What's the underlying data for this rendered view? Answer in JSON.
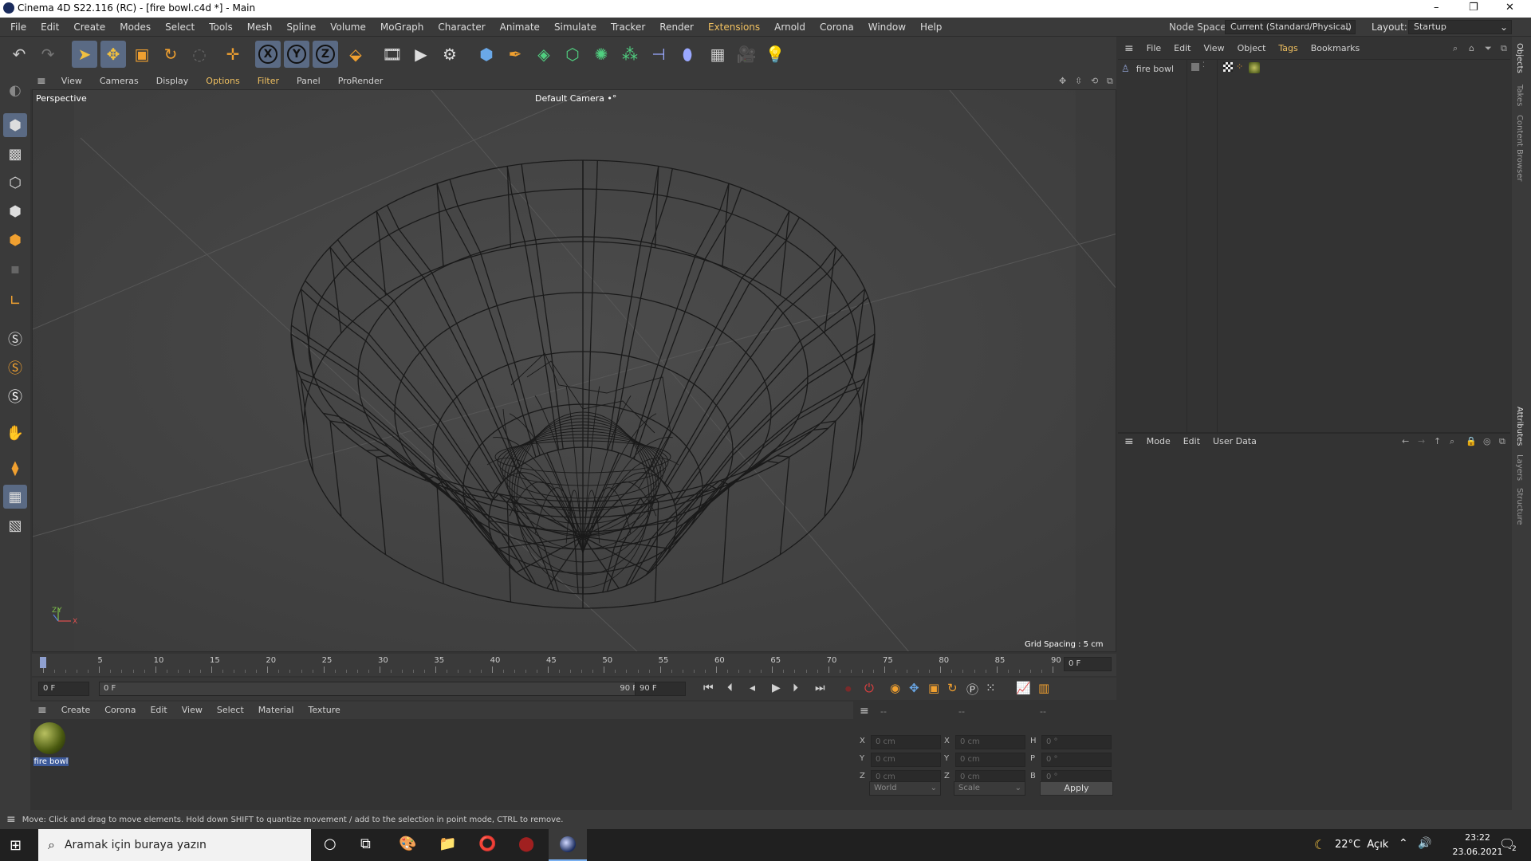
{
  "window": {
    "title": "Cinema 4D S22.116 (RC) - [fire bowl.c4d *] - Main",
    "controls": [
      "–",
      "❐",
      "✕"
    ]
  },
  "menubar": {
    "items": [
      "File",
      "Edit",
      "Create",
      "Modes",
      "Select",
      "Tools",
      "Mesh",
      "Spline",
      "Volume",
      "MoGraph",
      "Character",
      "Animate",
      "Simulate",
      "Tracker",
      "Render",
      "Extensions",
      "Arnold",
      "Corona",
      "Window",
      "Help"
    ],
    "node_space_label": "Node Space:",
    "node_space_value": "Current (Standard/Physical)",
    "layout_label": "Layout:",
    "layout_value": "Startup"
  },
  "toolbar": {
    "icons": [
      "undo-icon",
      "redo-icon",
      "select-cursor-icon",
      "move-icon",
      "scale-icon",
      "rotate-icon",
      "recent-icon",
      "add-object-icon",
      "lock-x-icon",
      "lock-y-icon",
      "lock-z-icon",
      "coordinate-system-icon",
      "render-view-icon",
      "render-picture-viewer-icon",
      "render-settings-icon",
      "cube-icon",
      "pen-icon",
      "subdivision-icon",
      "extrude-icon",
      "cloner-icon",
      "mograph-icon",
      "deformer-icon",
      "field-icon",
      "floor-icon",
      "camera-icon",
      "light-icon"
    ],
    "xyz": [
      "X",
      "Y",
      "Z"
    ]
  },
  "viewport": {
    "menu": [
      "View",
      "Cameras",
      "Display",
      "Options",
      "Filter",
      "Panel",
      "ProRender"
    ],
    "name": "Perspective",
    "camera": "Default Camera",
    "camera_suffix": "•°",
    "grid_spacing": "Grid Spacing : 5 cm",
    "axis": {
      "z": "Z",
      "y": "Y",
      "x": "X"
    }
  },
  "timeline": {
    "ticks": [
      "0",
      "5",
      "10",
      "15",
      "20",
      "25",
      "30",
      "35",
      "40",
      "45",
      "50",
      "55",
      "60",
      "65",
      "70",
      "75",
      "80",
      "85",
      "90"
    ],
    "current_frame": "0 F"
  },
  "transport": {
    "start_frame": "0 F",
    "slider_start": "0 F",
    "slider_end": "90 F",
    "end_frame": "90 F"
  },
  "material_manager": {
    "menu": [
      "Create",
      "Corona",
      "Edit",
      "View",
      "Select",
      "Material",
      "Texture"
    ],
    "materials": [
      {
        "name": "fire bowl"
      }
    ]
  },
  "coordinates": {
    "col_headers": [
      "--",
      "--",
      "--"
    ],
    "rows": [
      {
        "a": "X",
        "av": "0 cm",
        "b": "X",
        "bv": "0 cm",
        "c": "H",
        "cv": "0 °"
      },
      {
        "a": "Y",
        "av": "0 cm",
        "b": "Y",
        "bv": "0 cm",
        "c": "P",
        "cv": "0 °"
      },
      {
        "a": "Z",
        "av": "0 cm",
        "b": "Z",
        "bv": "0 cm",
        "c": "B",
        "cv": "0 °"
      }
    ],
    "mode1": "World",
    "mode2": "Scale",
    "apply": "Apply"
  },
  "objects": {
    "menu": [
      "File",
      "Edit",
      "View",
      "Object",
      "Tags",
      "Bookmarks"
    ],
    "items": [
      {
        "name": "fire bowl"
      }
    ]
  },
  "attributes": {
    "menu": [
      "Mode",
      "Edit",
      "User Data"
    ]
  },
  "side_tabs": [
    "Objects",
    "Takes",
    "Content Browser",
    "Attributes",
    "Layers",
    "Structure"
  ],
  "statusbar": {
    "text": "Move: Click and drag to move elements. Hold down SHIFT to quantize movement / add to the selection in point mode, CTRL to remove."
  },
  "taskbar": {
    "search_placeholder": "Aramak için buraya yazın",
    "weather": "22°C  Açık",
    "time": "23:22",
    "date": "23.06.2021",
    "notifications": "2"
  }
}
